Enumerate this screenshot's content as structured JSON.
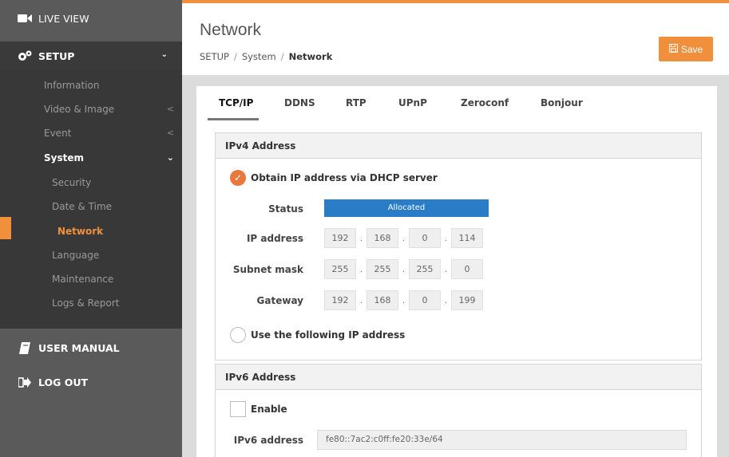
{
  "sidebar": {
    "live_view": "LIVE VIEW",
    "setup": "SETUP",
    "setup_chevron": "⌄",
    "items": [
      {
        "label": "Information"
      },
      {
        "label": "Video & Image",
        "arrow": "<"
      },
      {
        "label": "Event",
        "arrow": "<"
      },
      {
        "label": "System",
        "arrow": "⌄"
      },
      {
        "label": "Security"
      },
      {
        "label": "Date & Time"
      },
      {
        "label": "Network"
      },
      {
        "label": "Language"
      },
      {
        "label": "Maintenance"
      },
      {
        "label": "Logs & Report"
      }
    ],
    "user_manual": "USER MANUAL",
    "log_out": "LOG OUT"
  },
  "header": {
    "title": "Network",
    "breadcrumb": [
      "SETUP",
      "System",
      "Network"
    ],
    "breadcrumb_sep": "/",
    "save_label": "Save"
  },
  "tabs": [
    "TCP/IP",
    "DDNS",
    "RTP",
    "UPnP",
    "Zeroconf",
    "Bonjour"
  ],
  "ipv4": {
    "title": "IPv4 Address",
    "dhcp_option": "Obtain IP address via DHCP server",
    "status_label": "Status",
    "status_value": "Allocated",
    "ip_label": "IP address",
    "ip": [
      "192",
      "168",
      "0",
      "114"
    ],
    "subnet_label": "Subnet mask",
    "subnet": [
      "255",
      "255",
      "255",
      "0"
    ],
    "gateway_label": "Gateway",
    "gateway": [
      "192",
      "168",
      "0",
      "199"
    ],
    "static_option": "Use the following IP address",
    "octet_sep": "."
  },
  "ipv6": {
    "title": "IPv6 Address",
    "enable_label": "Enable",
    "addr_label": "IPv6 address",
    "addr_value": "fe80::7ac2:c0ff:fe20:33e/64"
  },
  "colors": {
    "accent": "#f0903c",
    "status_bar": "#2a7cc7"
  },
  "icons": {
    "live_view": "video-camera-icon",
    "setup": "gears-icon",
    "user_manual": "book-icon",
    "log_out": "sign-out-icon",
    "save": "floppy-disk-icon"
  }
}
